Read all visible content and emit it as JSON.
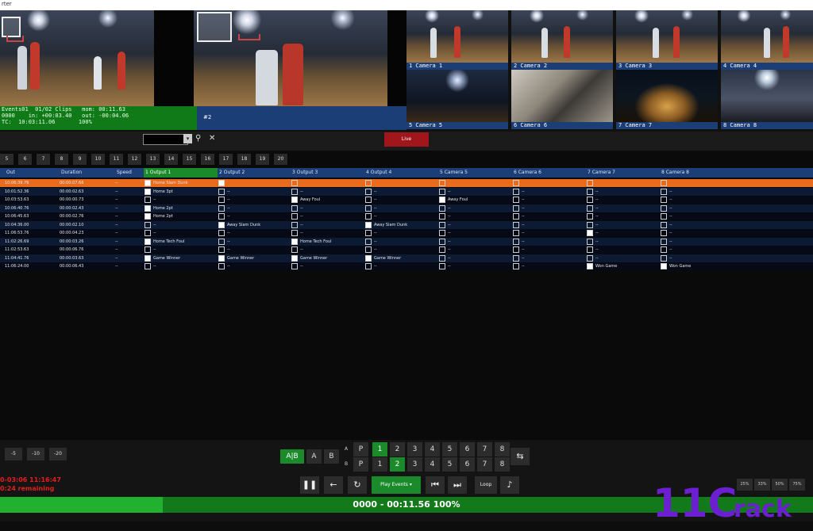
{
  "window": {
    "title": "rter"
  },
  "preview": {
    "status_lines": [
      "Events01  01/02 Clips   mom: 00:11.63",
      "0000    in: +00:03.40   out: -00:04.06",
      "TC:  10:03:11.06       100%"
    ],
    "output_label": "#2"
  },
  "cameras": [
    {
      "label": "1 Camera 1",
      "scene": "arena"
    },
    {
      "label": "2 Camera 2",
      "scene": "arena"
    },
    {
      "label": "3 Camera 3",
      "scene": "arena"
    },
    {
      "label": "4 Camera 4",
      "scene": "arena"
    },
    {
      "label": "5 Camera 5",
      "scene": "dark"
    },
    {
      "label": "6 Camera 6",
      "scene": "box"
    },
    {
      "label": "7 Camera 7",
      "scene": "court"
    },
    {
      "label": "8 Camera 8",
      "scene": "crowd"
    }
  ],
  "toolbar": {
    "search_value": "",
    "live_label": "Live",
    "search_icon": "magnifier-icon",
    "clear_icon": "x-icon"
  },
  "pages": [
    "5",
    "6",
    "7",
    "8",
    "9",
    "10",
    "11",
    "12",
    "13",
    "14",
    "15",
    "16",
    "17",
    "18",
    "19",
    "20"
  ],
  "grid": {
    "columns": [
      "Out",
      "Duration",
      "Speed",
      "1 Output 1",
      "2 Output 2",
      "3 Output 3",
      "4 Output 4",
      "5 Camera 5",
      "6 Camera 6",
      "7 Camera 7",
      "8 Camera 8"
    ],
    "rows": [
      {
        "out": "10:06:39.76",
        "dur": "00:00:07.66",
        "speed": "--",
        "cells": [
          {
            "c": true,
            "t": "Home Slam Dunk"
          },
          {
            "c": true,
            "t": ""
          },
          {
            "c": false,
            "t": ""
          },
          {
            "c": false,
            "t": ""
          },
          {
            "c": false,
            "t": ""
          },
          {
            "c": false,
            "t": ""
          },
          {
            "c": false,
            "t": ""
          },
          {
            "c": false,
            "t": ""
          }
        ]
      },
      {
        "out": "10:01:52.36",
        "dur": "00:00:02.63",
        "speed": "--",
        "cells": [
          {
            "c": true,
            "t": "Home 3pt"
          },
          {
            "c": false,
            "t": "--"
          },
          {
            "c": false,
            "t": "--"
          },
          {
            "c": false,
            "t": "--"
          },
          {
            "c": false,
            "t": "--"
          },
          {
            "c": false,
            "t": "--"
          },
          {
            "c": false,
            "t": "--"
          },
          {
            "c": false,
            "t": "--"
          }
        ]
      },
      {
        "out": "10:03:53.63",
        "dur": "00:00:00.73",
        "speed": "--",
        "cells": [
          {
            "c": false,
            "t": "--"
          },
          {
            "c": false,
            "t": "--"
          },
          {
            "c": true,
            "t": "Away Foul"
          },
          {
            "c": false,
            "t": "--"
          },
          {
            "c": true,
            "t": "Away Foul"
          },
          {
            "c": false,
            "t": "--"
          },
          {
            "c": false,
            "t": "--"
          },
          {
            "c": false,
            "t": "--"
          }
        ]
      },
      {
        "out": "10:06:40.76",
        "dur": "00:00:02.43",
        "speed": "--",
        "cells": [
          {
            "c": true,
            "t": "Home 2pt"
          },
          {
            "c": false,
            "t": "--"
          },
          {
            "c": false,
            "t": "--"
          },
          {
            "c": false,
            "t": "--"
          },
          {
            "c": false,
            "t": "--"
          },
          {
            "c": false,
            "t": "--"
          },
          {
            "c": false,
            "t": "--"
          },
          {
            "c": false,
            "t": "--"
          }
        ]
      },
      {
        "out": "10:06:45.63",
        "dur": "00:00:02.76",
        "speed": "--",
        "cells": [
          {
            "c": true,
            "t": "Home 2pt"
          },
          {
            "c": false,
            "t": "--"
          },
          {
            "c": false,
            "t": "--"
          },
          {
            "c": false,
            "t": "--"
          },
          {
            "c": false,
            "t": "--"
          },
          {
            "c": false,
            "t": "--"
          },
          {
            "c": false,
            "t": "--"
          },
          {
            "c": false,
            "t": "--"
          }
        ]
      },
      {
        "out": "10:04:36.00",
        "dur": "00:00:02.10",
        "speed": "--",
        "cells": [
          {
            "c": false,
            "t": "--"
          },
          {
            "c": true,
            "t": "Away Slam Dunk"
          },
          {
            "c": false,
            "t": "--"
          },
          {
            "c": true,
            "t": "Away Slam Dunk"
          },
          {
            "c": false,
            "t": "--"
          },
          {
            "c": false,
            "t": "--"
          },
          {
            "c": false,
            "t": "--"
          },
          {
            "c": false,
            "t": "--"
          }
        ]
      },
      {
        "out": "11:06:53.76",
        "dur": "00:00:04.23",
        "speed": "--",
        "cells": [
          {
            "c": false,
            "t": "--"
          },
          {
            "c": false,
            "t": "--"
          },
          {
            "c": false,
            "t": "--"
          },
          {
            "c": false,
            "t": "--"
          },
          {
            "c": false,
            "t": "--"
          },
          {
            "c": false,
            "t": "--"
          },
          {
            "c": true,
            "t": "--"
          },
          {
            "c": false,
            "t": "--"
          }
        ]
      },
      {
        "out": "11:02:26.69",
        "dur": "00:00:03.26",
        "speed": "--",
        "cells": [
          {
            "c": true,
            "t": "Home Tech Foul"
          },
          {
            "c": false,
            "t": "--"
          },
          {
            "c": true,
            "t": "Home Tech Foul"
          },
          {
            "c": false,
            "t": "--"
          },
          {
            "c": false,
            "t": "--"
          },
          {
            "c": false,
            "t": "--"
          },
          {
            "c": false,
            "t": "--"
          },
          {
            "c": false,
            "t": "--"
          }
        ]
      },
      {
        "out": "11:02:53.63",
        "dur": "00:00:06.76",
        "speed": "--",
        "cells": [
          {
            "c": false,
            "t": "--"
          },
          {
            "c": false,
            "t": "--"
          },
          {
            "c": false,
            "t": "--"
          },
          {
            "c": false,
            "t": "--"
          },
          {
            "c": false,
            "t": "--"
          },
          {
            "c": false,
            "t": "--"
          },
          {
            "c": false,
            "t": "--"
          },
          {
            "c": false,
            "t": "--"
          }
        ]
      },
      {
        "out": "11:04:41.76",
        "dur": "00:00:03.63",
        "speed": "--",
        "cells": [
          {
            "c": true,
            "t": "Game Winner"
          },
          {
            "c": true,
            "t": "Game Winner"
          },
          {
            "c": true,
            "t": "Game Winner"
          },
          {
            "c": true,
            "t": "Game Winner"
          },
          {
            "c": false,
            "t": "--"
          },
          {
            "c": false,
            "t": "--"
          },
          {
            "c": false,
            "t": "--"
          },
          {
            "c": false,
            "t": "--"
          }
        ]
      },
      {
        "out": "11:06:24.00",
        "dur": "00:00:06.43",
        "speed": "--",
        "cells": [
          {
            "c": false,
            "t": "--"
          },
          {
            "c": false,
            "t": "--"
          },
          {
            "c": false,
            "t": "--"
          },
          {
            "c": false,
            "t": "--"
          },
          {
            "c": false,
            "t": "--"
          },
          {
            "c": false,
            "t": "--"
          },
          {
            "c": true,
            "t": "Won Game"
          },
          {
            "c": true,
            "t": "Won Game"
          }
        ]
      }
    ]
  },
  "controls": {
    "nudge": [
      "-5",
      "-10",
      "-20"
    ],
    "ab": [
      "A|B",
      "A",
      "B"
    ],
    "row_a_label": "A",
    "row_b_label": "B",
    "p_label": "P",
    "keys": [
      "1",
      "2",
      "3",
      "4",
      "5",
      "6",
      "7",
      "8"
    ],
    "row_a_active": "1",
    "row_b_active": "2",
    "play_events_label": "Play Events",
    "loop_label": "Loop",
    "clock_line": "0-03:06 11:16:47",
    "remaining_line": "0:24 remaining",
    "zoom": [
      "25%",
      "33%",
      "50%",
      "75%"
    ],
    "icons": [
      "pause-icon",
      "back-arrow-icon",
      "replay-icon",
      "skip-prev-icon",
      "skip-next-icon",
      "music-note-icon",
      "swap-icon"
    ]
  },
  "progress": {
    "text": "0000 - 00:11.56   100%",
    "fraction": 0.2
  },
  "watermark": {
    "text_a": "11C",
    "text_b": "rack"
  },
  "colors": {
    "green": "#1b8a2a",
    "blue": "#1c3e77",
    "orange": "#e86b1e",
    "red": "#a0161a"
  }
}
